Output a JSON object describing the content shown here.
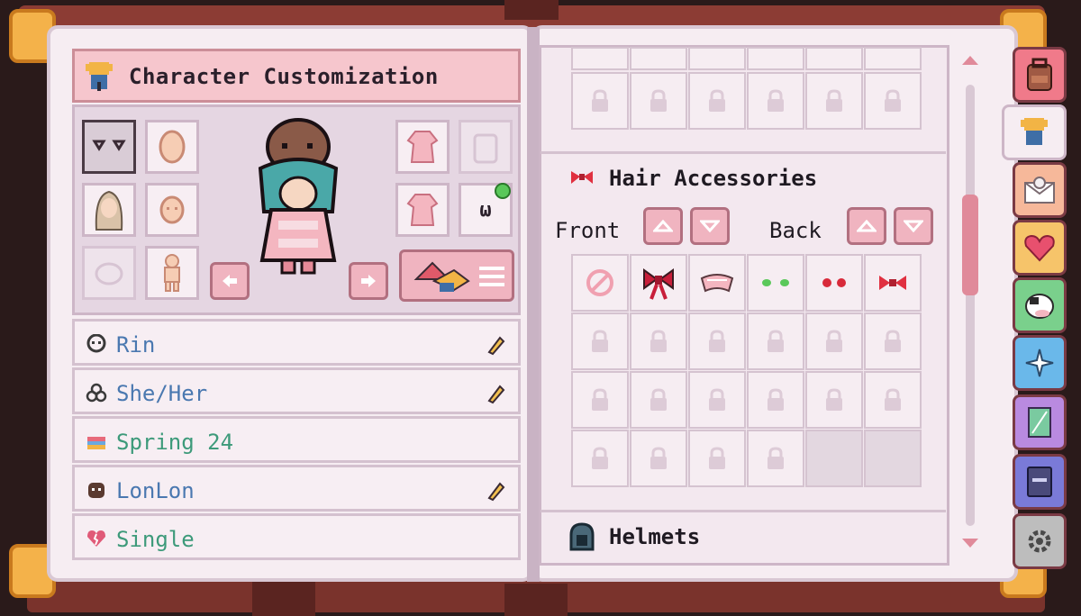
{
  "header": {
    "title": "Character Customization"
  },
  "profile": [
    {
      "id": "name",
      "value": "Rin",
      "color": "#4a78b0",
      "editable": true,
      "icon": "skull-icon"
    },
    {
      "id": "pronouns",
      "value": "She/Her",
      "color": "#4a78b0",
      "editable": true,
      "icon": "trefoil-icon"
    },
    {
      "id": "birthday",
      "value": "Spring 24",
      "color": "#3d9a7a",
      "editable": false,
      "icon": "cake-icon"
    },
    {
      "id": "pet",
      "value": "LonLon",
      "color": "#4a78b0",
      "editable": true,
      "icon": "pet-icon"
    },
    {
      "id": "status",
      "value": "Single",
      "color": "#3d9a7a",
      "editable": false,
      "icon": "broken-heart-icon"
    }
  ],
  "slot_text": {
    "mouth": "ω"
  },
  "right_panel": {
    "section_title": "Hair Accessories",
    "front_label": "Front",
    "back_label": "Back",
    "next_section": "Helmets"
  },
  "tabs": [
    {
      "name": "backpack-tab",
      "color": "#f07a8a"
    },
    {
      "name": "appearance-tab",
      "color": "#f6edf2"
    },
    {
      "name": "mail-tab",
      "color": "#f6b89a"
    },
    {
      "name": "relationships-tab",
      "color": "#f6c46a"
    },
    {
      "name": "creatures-tab",
      "color": "#7ad08c"
    },
    {
      "name": "skills-tab",
      "color": "#6ab8ea"
    },
    {
      "name": "map-tab",
      "color": "#b98ae0"
    },
    {
      "name": "journal-tab",
      "color": "#7a7ad8"
    },
    {
      "name": "settings-tab",
      "color": "#bdbdbd"
    }
  ],
  "colors": {
    "accent": "#f0b4c0",
    "page": "#f6edf2",
    "leather": "#8c3c34"
  }
}
